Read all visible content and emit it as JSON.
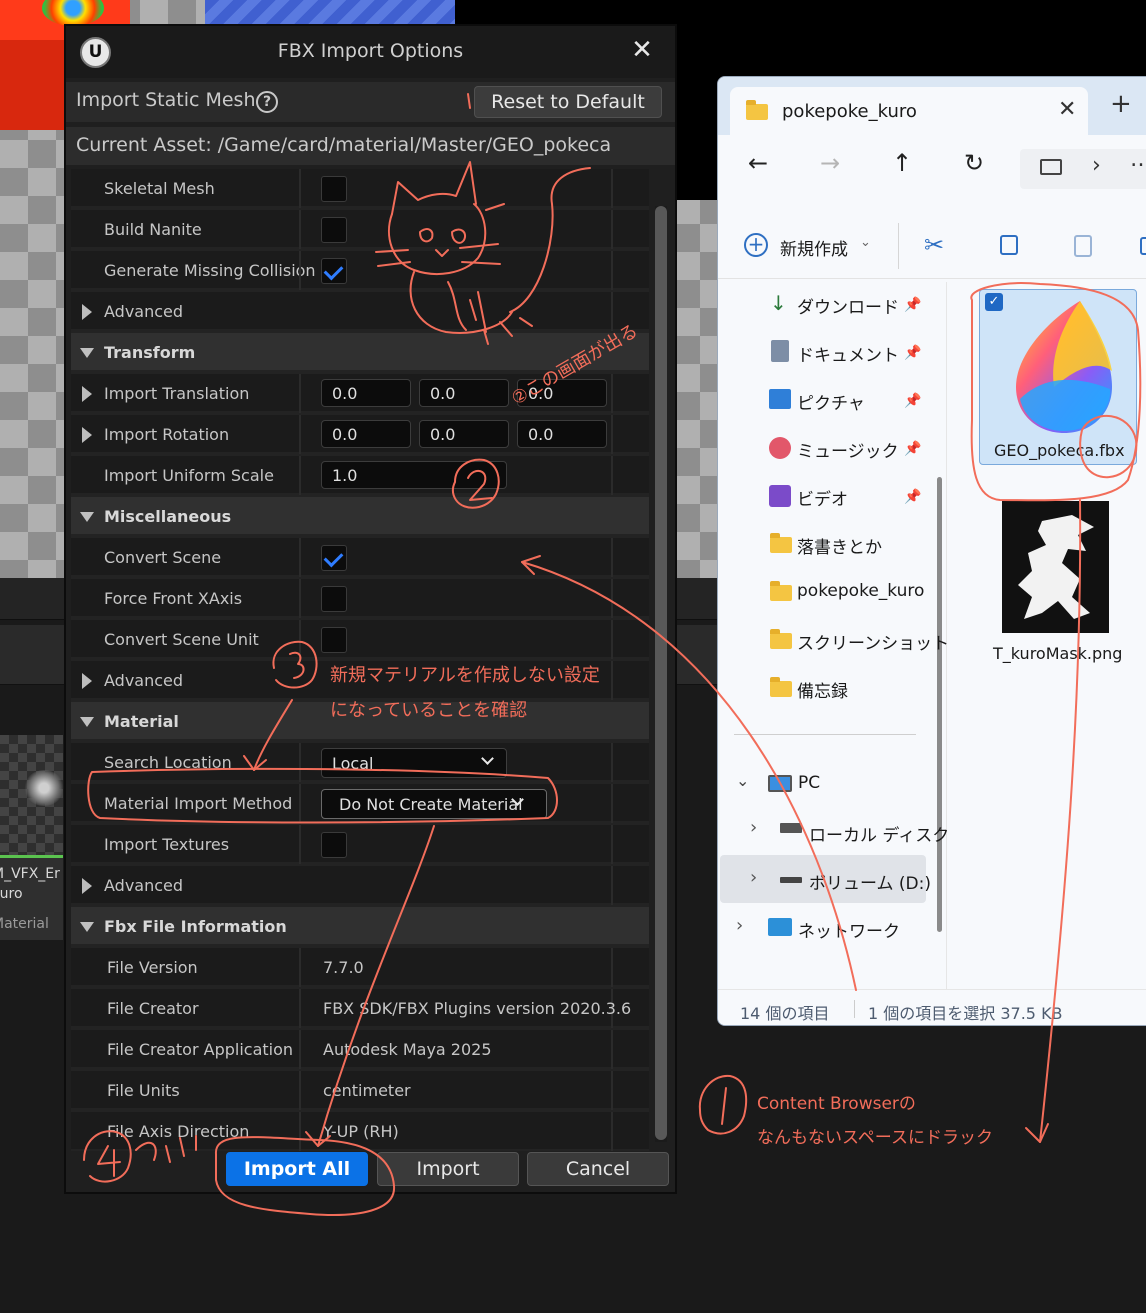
{
  "dialog": {
    "title": "FBX Import Options",
    "close_icon": "✕",
    "header": "Import Static Mesh",
    "help_icon": "?",
    "reset_button": "Reset to Default",
    "current_asset": "Current Asset:  /Game/card/material/Master/GEO_pokeca",
    "rows": {
      "skeletal_mesh": "Skeletal Mesh",
      "build_nanite": "Build Nanite",
      "generate_missing_collision": "Generate Missing Collision",
      "advanced_1": "Advanced",
      "transform": "Transform",
      "import_translation": "Import Translation",
      "translation_x": "0.0",
      "translation_y": "0.0",
      "translation_z": "0.0",
      "import_rotation": "Import Rotation",
      "rotation_x": "0.0",
      "rotation_y": "0.0",
      "rotation_z": "0.0",
      "import_uniform_scale": "Import Uniform Scale",
      "uniform_scale_value": "1.0",
      "miscellaneous": "Miscellaneous",
      "convert_scene": "Convert Scene",
      "force_front_xaxis": "Force Front XAxis",
      "convert_scene_unit": "Convert Scene Unit",
      "advanced_2": "Advanced",
      "material": "Material",
      "search_location": "Search Location",
      "search_location_value": "Local",
      "material_import_method": "Material Import Method",
      "material_import_method_value": "Do Not Create Material",
      "import_textures": "Import Textures",
      "advanced_3": "Advanced",
      "fbx_file_information": "Fbx File Information",
      "file_version": "File Version",
      "file_version_value": "7.7.0",
      "file_creator": "File Creator",
      "file_creator_value": "FBX SDK/FBX Plugins version 2020.3.6",
      "file_creator_application": "File Creator Application",
      "file_creator_application_value": "Autodesk Maya 2025",
      "file_units": "File Units",
      "file_units_value": "centimeter",
      "file_axis_direction": "File Axis Direction",
      "file_axis_direction_value": "Y-UP (RH)"
    },
    "checkboxes": {
      "skeletal_mesh": false,
      "build_nanite": false,
      "generate_missing_collision": true,
      "convert_scene": true,
      "force_front_xaxis": false,
      "convert_scene_unit": false,
      "import_textures": false
    },
    "buttons": {
      "import_all": "Import All",
      "import": "Import",
      "cancel": "Cancel"
    }
  },
  "explorer": {
    "tab_title": "pokepoke_kuro",
    "tab_close": "✕",
    "new_tab": "+",
    "new_button": "新規作成",
    "nav_items": {
      "downloads": "ダウンロード",
      "documents": "ドキュメント",
      "pictures": "ピクチャ",
      "music": "ミュージック",
      "videos": "ビデオ",
      "rakugaki": "落書きとか",
      "pokepoke_kuro": "pokepoke_kuro",
      "screenshots": "スクリーンショット",
      "memo": "備忘録",
      "pc": "PC",
      "local_disk": "ローカル ディスク",
      "volume_d": "ボリューム (D:)",
      "network": "ネットワーク"
    },
    "files": {
      "file1": "GEO_pokeca.fbx",
      "file2": "T_kuroMask.png"
    },
    "status": {
      "count": "14 個の項目",
      "selected": "1 個の項目を選択  37.5 KB"
    }
  },
  "content_browser": {
    "asset_label_1": "M_VFX_Er",
    "asset_label_2": "kuro",
    "asset_type": "Material"
  },
  "annotations": {
    "note_1_circle": "1",
    "note_1_line1": "Content Browserの",
    "note_1_line2": "なんもないスペースにドラック",
    "note_2": "②この画面が出る",
    "note_3_circle": "3",
    "note_3_line1": "新規マテリアルを作成しない設定",
    "note_3_line2": "になっていることを確認",
    "note_4": "④クリック"
  },
  "colors": {
    "accent_blue": "#0b72e7",
    "annotation_red": "#f26d5a",
    "check_blue": "#2f7dff"
  }
}
